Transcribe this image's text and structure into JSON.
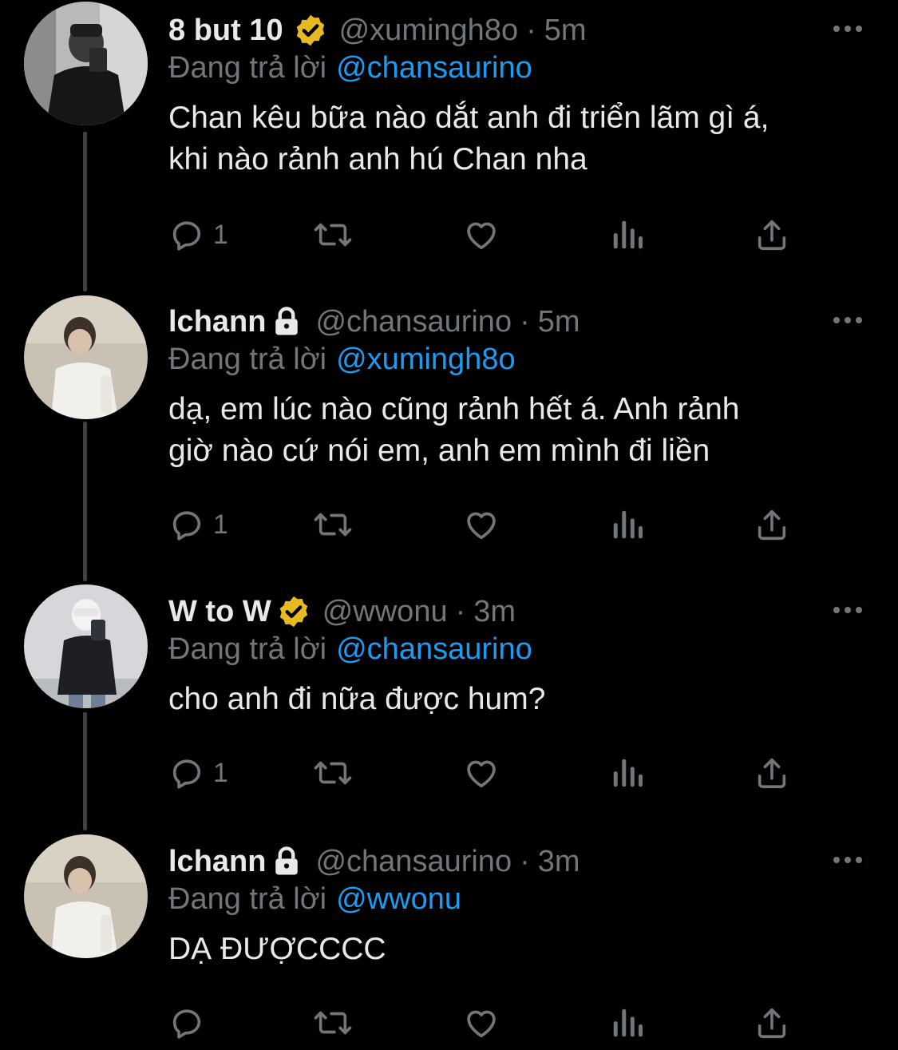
{
  "colors": {
    "background": "#000000",
    "text": "#e7e9ea",
    "muted": "#71767b",
    "mention": "#1d9bf0",
    "verified": "#e8b923",
    "thread_line": "#3e4144"
  },
  "replying_label": "Đang trả lời",
  "tweets": [
    {
      "display_name": "8 but 10",
      "badge": "verified-gold-icon",
      "handle": "@xumingh8o",
      "time": "5m",
      "replying_to": "@chansaurino",
      "text": "Chan kêu bữa nào dắt anh đi triển lãm gì á,\nkhi nào rảnh anh hú Chan nha",
      "reply_count": "1"
    },
    {
      "display_name": "lchann",
      "badge": "lock-icon",
      "handle": "@chansaurino",
      "time": "5m",
      "replying_to": "@xumingh8o",
      "text": "dạ, em lúc nào cũng rảnh hết á. Anh rảnh\ngiờ nào cứ nói em, anh em mình đi liền",
      "reply_count": "1"
    },
    {
      "display_name": "W to W",
      "badge": "verified-gold-icon",
      "handle": "@wwonu",
      "time": "3m",
      "replying_to": "@chansaurino",
      "text": "cho anh đi nữa được hum?",
      "reply_count": "1"
    },
    {
      "display_name": "lchann",
      "badge": "lock-icon",
      "handle": "@chansaurino",
      "time": "3m",
      "replying_to": "@wwonu",
      "text": "DẠ ĐƯỢCCCC",
      "reply_count": ""
    }
  ]
}
